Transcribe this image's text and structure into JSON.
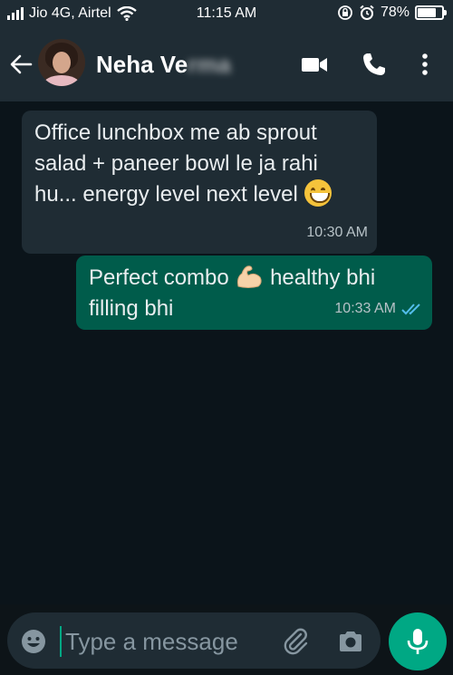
{
  "status_bar": {
    "carrier": "Jio 4G, Airtel",
    "time": "11:15 AM",
    "battery_percent": "78%",
    "battery_level": 0.78
  },
  "header": {
    "contact_name_visible": "Neha Ve",
    "contact_name_blurred": "rma",
    "icons": [
      "back-arrow-icon",
      "avatar",
      "video-call-icon",
      "phone-icon",
      "more-vert-icon"
    ]
  },
  "messages": [
    {
      "direction": "incoming",
      "text": "Office lunchbox me ab sprout\nsalad + paneer bowl le ja rahi\nhu... energy level next level",
      "emoji": "grinning-face",
      "time": "10:30 AM"
    },
    {
      "direction": "outgoing",
      "text_part1": "Perfect combo",
      "emoji": "flexed-biceps",
      "text_part2": "healthy bhi\nfilling bhi",
      "time": "10:33 AM",
      "status": "read"
    }
  ],
  "composer": {
    "placeholder": "Type a message"
  },
  "colors": {
    "header_bg": "#1f2c34",
    "chat_bg": "#0b141a",
    "incoming_bubble": "#1f2c34",
    "outgoing_bubble": "#005c4b",
    "accent": "#00a884",
    "read_ticks": "#53bdeb"
  }
}
